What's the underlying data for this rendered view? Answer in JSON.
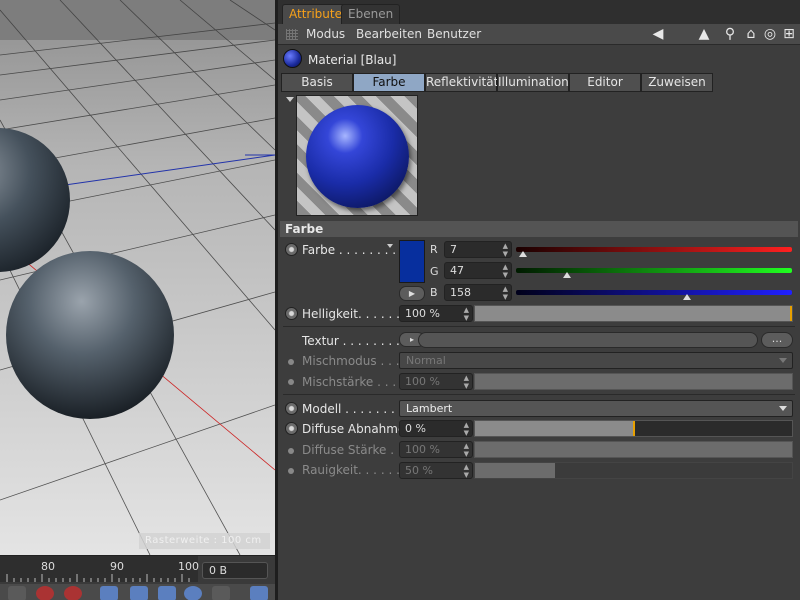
{
  "timeline": {
    "ticks": [
      "80",
      "90",
      "100"
    ],
    "frame": "0 B"
  },
  "viewport": {
    "status": "Rasterweite : 100 cm"
  },
  "tabs": [
    {
      "label": "Attribute"
    },
    {
      "label": "Ebenen"
    }
  ],
  "menu": {
    "items": [
      "Modus",
      "Bearbeiten",
      "Benutzer"
    ]
  },
  "material": {
    "title": "Material [Blau]"
  },
  "material_tabs": [
    "Basis",
    "Farbe",
    "Reflektivität",
    "Illumination",
    "Editor",
    "Zuweisen"
  ],
  "section": {
    "title": "Farbe"
  },
  "color": {
    "label": "Farbe . . . . . . . .",
    "swatch": "#072f9e",
    "r_label": "R",
    "r_value": "7",
    "r_level": 0.027,
    "g_label": "G",
    "g_value": "47",
    "g_level": 0.184,
    "b_label": "B",
    "b_value": "158",
    "b_level": 0.62
  },
  "brightness": {
    "label": "Helligkeit. . . . . . .",
    "value": "100 %",
    "level": 1.0
  },
  "texture": {
    "label": "Textur . . . . . . . . .",
    "btn": "...",
    "arrow_btn": "▸"
  },
  "mix_mode": {
    "label": "Mischmodus . . . . .",
    "value": "Normal"
  },
  "mix_strength": {
    "label": "Mischstärke . . . .",
    "value": "100 %",
    "level": 1.0
  },
  "model": {
    "label": "Modell . . . . . . . . .",
    "value": "Lambert"
  },
  "diffuse_falloff": {
    "label": "Diffuse Abnahme",
    "value": "0 %",
    "level": 0.5
  },
  "diffuse_strength": {
    "label": "Diffuse Stärke . . .",
    "value": "100 %",
    "level": 1.0
  },
  "roughness": {
    "label": "Rauigkeit. . . . . . . .",
    "value": "50 %",
    "level": 0.5
  }
}
